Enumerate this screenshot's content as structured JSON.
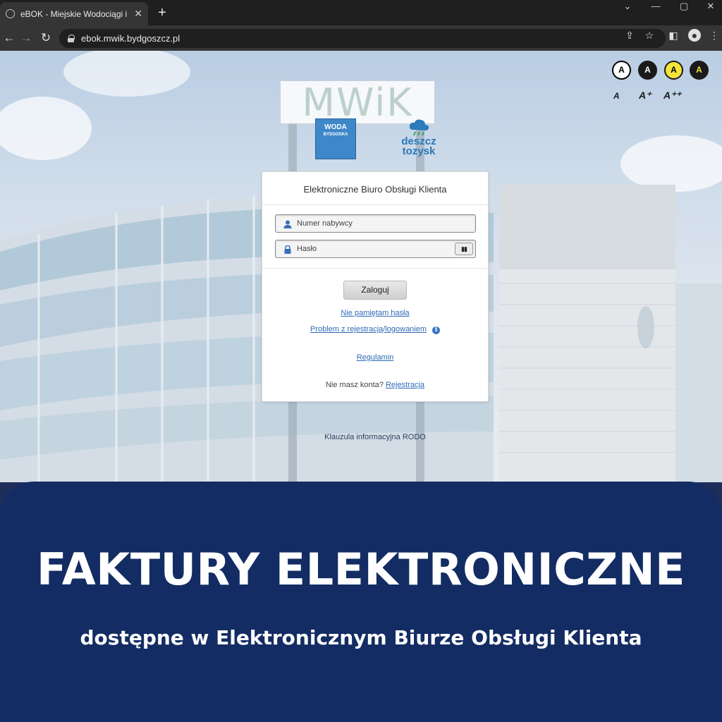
{
  "browser": {
    "tab_title": "eBOK - Miejskie Wodociągi i Kanalizacja",
    "tab_close": "✕",
    "new_tab": "+",
    "url": "ebok.mwik.bydgoszcz.pl"
  },
  "accessibility": {
    "contrast_options": [
      {
        "label": "A",
        "bg": "#ffffff",
        "fg": "#000000",
        "border": "#000000"
      },
      {
        "label": "A",
        "bg": "#1a1a1a",
        "fg": "#ffffff",
        "border": "#1a1a1a"
      },
      {
        "label": "A",
        "bg": "#f5e43b",
        "fg": "#000000",
        "border": "#1a1a1a"
      },
      {
        "label": "A",
        "bg": "#1a1a1a",
        "fg": "#f5e43b",
        "border": "#1a1a1a"
      }
    ],
    "font_sizes": [
      "A",
      "A⁺",
      "A⁺⁺"
    ]
  },
  "logos": {
    "sign": "MWiK",
    "woda": "WODA",
    "woda_sub": "BYDGOSKA",
    "deszcz_line1": "deszcz",
    "deszcz_line2": "tozysk"
  },
  "login": {
    "title": "Elektroniczne Biuro Obsługi Klienta",
    "username_placeholder": "Numer nabywcy",
    "password_placeholder": "Hasło",
    "show_password": "▮▮",
    "submit_label": "Zaloguj",
    "forgot_password": "Nie pamiętam hasła",
    "problem_link": "Problem z rejestracją/logowaniem",
    "info_icon": "i",
    "terms": "Regulamin",
    "no_account": "Nie masz konta?",
    "register": "Rejestracja"
  },
  "rodo": "Klauzula informacyjna RODO",
  "banner": {
    "title": "FAKTURY ELEKTRONICZNE",
    "subtitle": "dostępne w Elektronicznym Biurze Obsługi Klienta"
  },
  "colors": {
    "banner_bg": "#132c63",
    "link": "#2e6bb5",
    "chrome_dark": "#1f1f1f"
  }
}
